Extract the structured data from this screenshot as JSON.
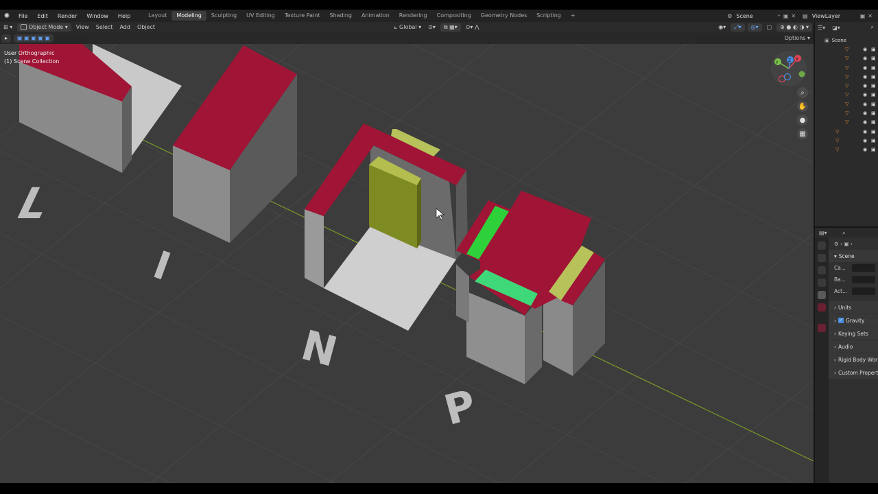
{
  "menu": {
    "items": [
      "File",
      "Edit",
      "Render",
      "Window",
      "Help"
    ]
  },
  "workspaces": {
    "tabs": [
      "Layout",
      "Modeling",
      "Sculpting",
      "UV Editing",
      "Texture Paint",
      "Shading",
      "Animation",
      "Rendering",
      "Compositing",
      "Geometry Nodes",
      "Scripting"
    ],
    "active": "Modeling",
    "add_label": "+"
  },
  "topright": {
    "scene_label": "Scene",
    "viewlayer_label": "ViewLayer"
  },
  "viewport_header": {
    "mode": "Object Mode",
    "view": "View",
    "select": "Select",
    "add": "Add",
    "object": "Object",
    "transform_orientation": "Global",
    "options": "Options"
  },
  "viewport": {
    "view_name": "User Orthographic",
    "collection": "(1) Scene Collection",
    "letters": [
      "L",
      "I",
      "N",
      "P"
    ],
    "gizmo_labels": [
      "X",
      "Y",
      "Z"
    ]
  },
  "outliner": {
    "root": "Scene",
    "row_count": 12
  },
  "properties": {
    "scene_title": "Scene",
    "fields": [
      {
        "label": "Ca..."
      },
      {
        "label": "Ba..."
      },
      {
        "label": "Act..."
      }
    ],
    "panels": [
      "Units",
      "Gravity",
      "Keying Sets",
      "Audio",
      "Rigid Body World",
      "Custom Properti..."
    ],
    "gravity_checked": true
  },
  "colors": {
    "viewport_bg": "#3c3c3c",
    "crimson": "#a01436",
    "gray_side": "#7a7a7a",
    "light_gray": "#c8c8c8",
    "olive": "#8a9428",
    "green": "#2ed13a",
    "green2": "#3fd878",
    "yellowgreen": "#b8c25a"
  }
}
